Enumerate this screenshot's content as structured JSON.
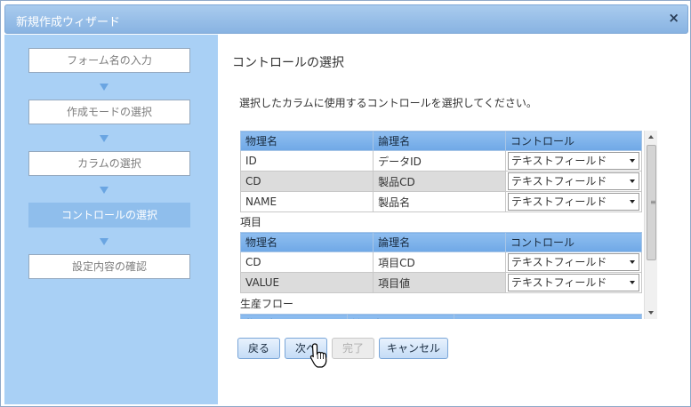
{
  "window": {
    "title": "新規作成ウィザード",
    "close_icon": "×"
  },
  "sidebar": {
    "steps": [
      {
        "label": "フォーム名の入力",
        "active": false
      },
      {
        "label": "作成モードの選択",
        "active": false
      },
      {
        "label": "カラムの選択",
        "active": false
      },
      {
        "label": "コントロールの選択",
        "active": true
      },
      {
        "label": "設定内容の確認",
        "active": false
      }
    ],
    "accent_color": "#a9d0f5",
    "active_color": "#8fbeec"
  },
  "main": {
    "title": "コントロールの選択",
    "instruction": "選択したカラムに使用するコントロールを選択してください。",
    "headers": {
      "physical": "物理名",
      "logical": "論理名",
      "control": "コントロール"
    },
    "groups": [
      {
        "label": "",
        "rows": [
          {
            "physical": "ID",
            "logical": "データID",
            "control": "テキストフィールド"
          },
          {
            "physical": "CD",
            "logical": "製品CD",
            "control": "テキストフィールド"
          },
          {
            "physical": "NAME",
            "logical": "製品名",
            "control": "テキストフィールド"
          }
        ]
      },
      {
        "label": "項目",
        "rows": [
          {
            "physical": "CD",
            "logical": "項目CD",
            "control": "テキストフィールド"
          },
          {
            "physical": "VALUE",
            "logical": "項目値",
            "control": "テキストフィールド"
          }
        ]
      },
      {
        "label": "生産フロー",
        "rows": []
      }
    ]
  },
  "buttons": {
    "back": "戻る",
    "next": "次へ",
    "finish": "完了",
    "cancel": "キャンセル"
  }
}
